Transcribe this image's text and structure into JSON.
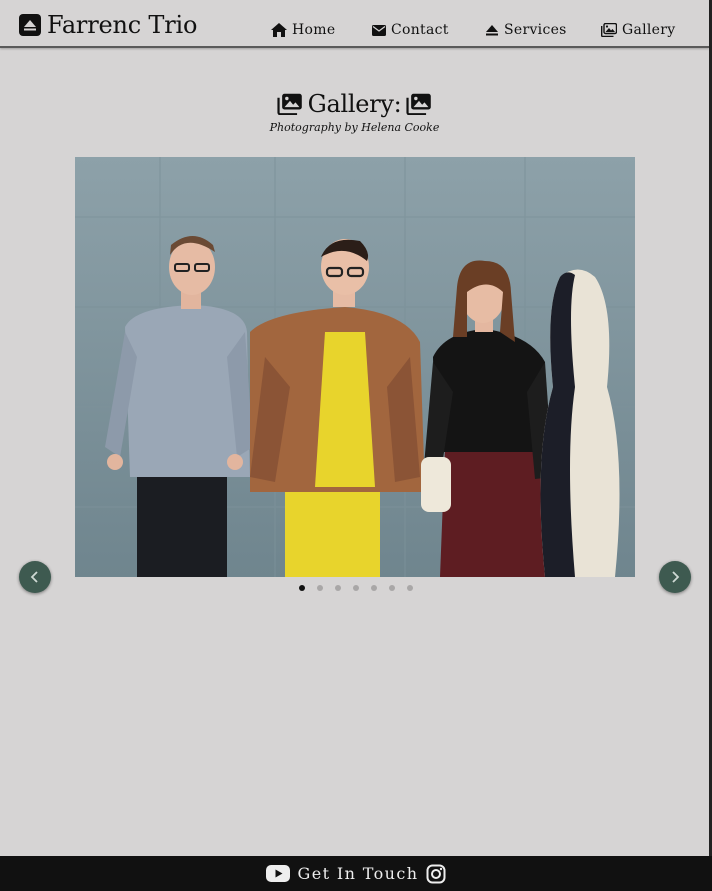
{
  "header": {
    "brand": "Farrenc Trio",
    "brand_icon": "eject-square-icon",
    "nav": [
      {
        "label": "Home",
        "icon": "home-icon"
      },
      {
        "label": "Contact",
        "icon": "envelope-icon"
      },
      {
        "label": "Services",
        "icon": "eject-icon"
      },
      {
        "label": "Gallery",
        "icon": "images-icon"
      }
    ]
  },
  "gallery": {
    "title": "Gallery:",
    "subtitle": "Photography by Helena Cooke",
    "slide_count": 7,
    "active_slide": 1,
    "photo_description_icon": "photo-image"
  },
  "footer": {
    "label": "Get In Touch",
    "icons": [
      "youtube-icon",
      "instagram-icon"
    ]
  },
  "colors": {
    "background": "#d6d4d4",
    "arrow": "#3e5a50",
    "footer": "#111111"
  }
}
